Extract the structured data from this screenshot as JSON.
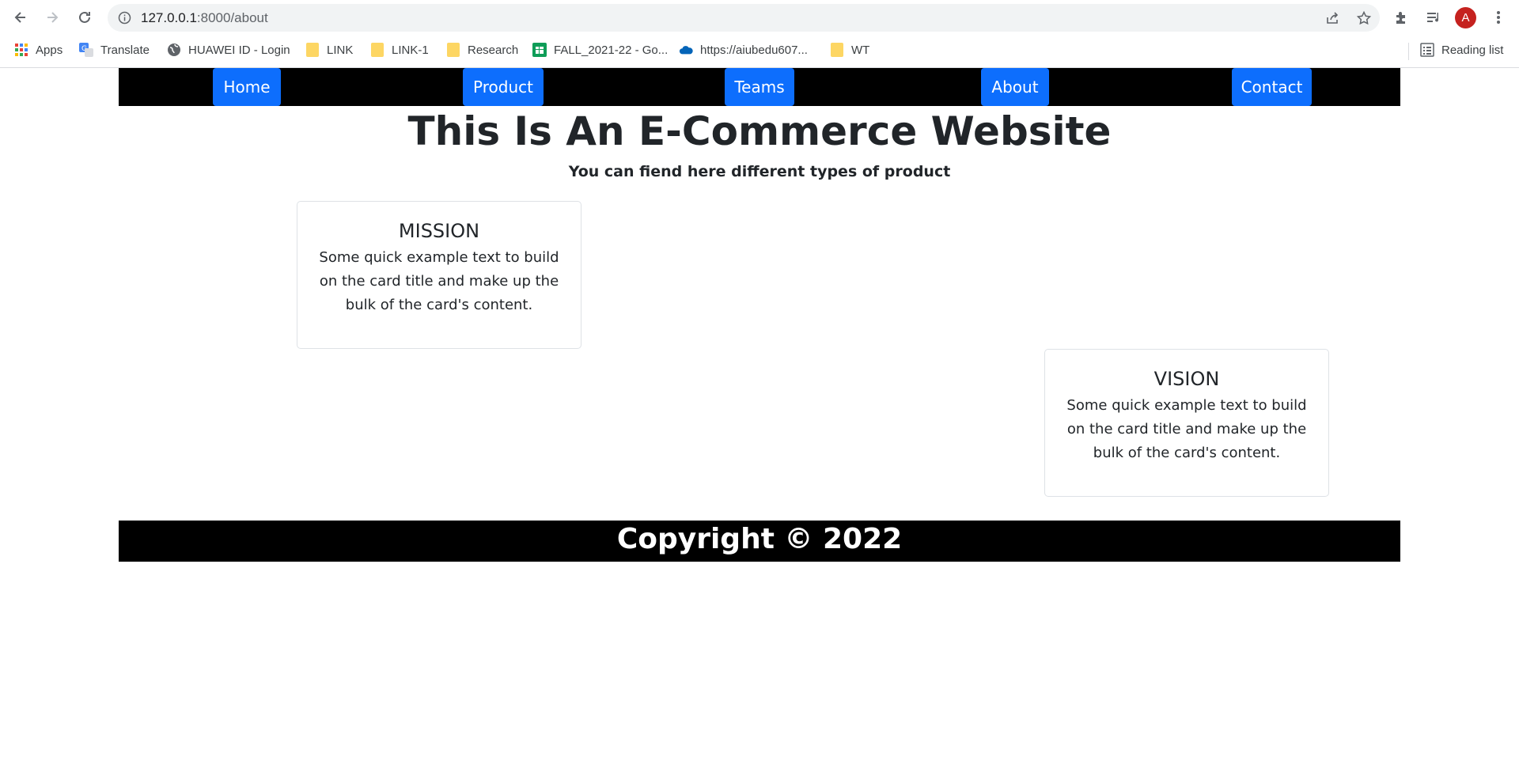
{
  "browser": {
    "url_host": "127.0.0.1",
    "url_path": ":8000/about",
    "profile_initial": "A",
    "bookmarks": [
      {
        "label": "Apps",
        "icon": "apps-grid-icon"
      },
      {
        "label": "Translate",
        "icon": "translate-icon"
      },
      {
        "label": "HUAWEI ID - Login",
        "icon": "globe-icon"
      },
      {
        "label": "LINK",
        "icon": "folder-icon"
      },
      {
        "label": "LINK-1",
        "icon": "folder-icon"
      },
      {
        "label": "Research",
        "icon": "folder-icon"
      },
      {
        "label": "FALL_2021-22 - Go...",
        "icon": "sheets-icon"
      },
      {
        "label": "https://aiubedu607...",
        "icon": "onedrive-icon"
      },
      {
        "label": "WT",
        "icon": "folder-icon"
      }
    ],
    "reading_list": "Reading list"
  },
  "nav": {
    "items": [
      "Home",
      "Product",
      "Teams",
      "About",
      "Contact"
    ]
  },
  "header": {
    "title": "This Is An E-Commerce Website",
    "subtitle": "You can fiend here different types of product"
  },
  "cards": [
    {
      "title": "MISSION",
      "text": "Some quick example text to build on the card title and make up the bulk of the card's content."
    },
    {
      "title": "VISION",
      "text": "Some quick example text to build on the card title and make up the bulk of the card's content."
    }
  ],
  "footer": {
    "text": "Copyright © 2022"
  },
  "colors": {
    "nav_button": "#0d6efd",
    "nav_bar": "#000000",
    "footer_bg": "#000000",
    "avatar": "#c5221f"
  }
}
